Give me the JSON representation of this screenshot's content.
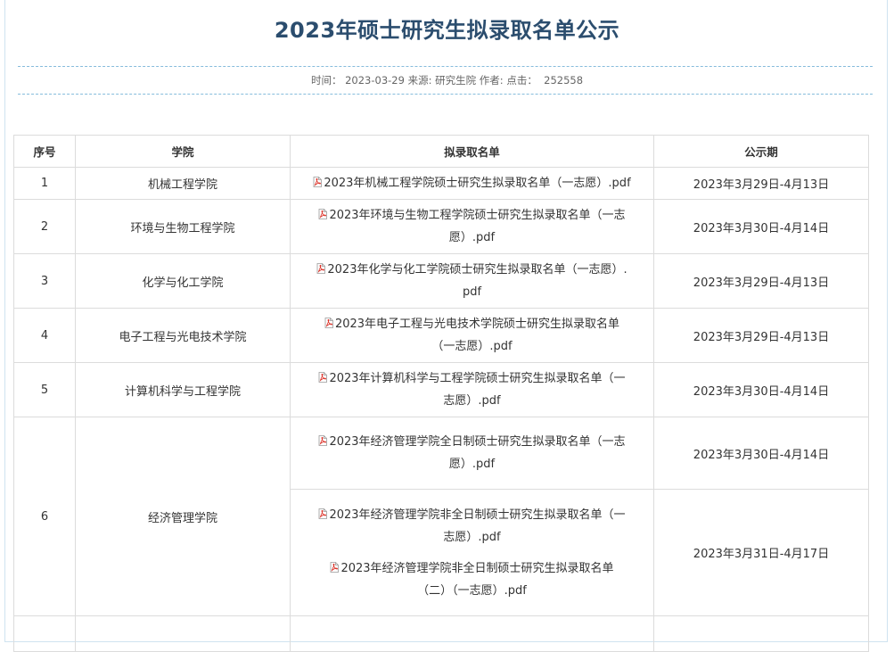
{
  "article": {
    "title": "2023年硕士研究生拟录取名单公示",
    "meta": {
      "time_label": "时间：",
      "time_value": "2023-03-29",
      "source_label": "来源:",
      "source_value": "研究生院",
      "author_label": "作者:",
      "clicks_label": "点击：",
      "clicks_value": "252558"
    }
  },
  "table": {
    "headers": [
      "序号",
      "学院",
      "拟录取名单",
      "公示期"
    ],
    "rows": [
      {
        "no": "1",
        "college": "机械工程学院",
        "files": [
          {
            "line1": "2023年机械工程学院硕士研究生拟录取名单（一志愿）.pdf",
            "line2": ""
          }
        ],
        "period": "2023年3月29日-4月13日"
      },
      {
        "no": "2",
        "college": "环境与生物工程学院",
        "files": [
          {
            "line1": "2023年环境与生物工程学院硕士研究生拟录取名单（一志",
            "line2": "愿）.pdf"
          }
        ],
        "period": "2023年3月30日-4月14日"
      },
      {
        "no": "3",
        "college": "化学与化工学院",
        "files": [
          {
            "line1": "2023年化学与化工学院硕士研究生拟录取名单（一志愿）.",
            "line2": "pdf"
          }
        ],
        "period": "2023年3月29日-4月13日"
      },
      {
        "no": "4",
        "college": "电子工程与光电技术学院",
        "files": [
          {
            "line1": "2023年电子工程与光电技术学院硕士研究生拟录取名单",
            "line2": "（一志愿）.pdf"
          }
        ],
        "period": "2023年3月29日-4月13日"
      },
      {
        "no": "5",
        "college": "计算机科学与工程学院",
        "files": [
          {
            "line1": "2023年计算机科学与工程学院硕士研究生拟录取名单（一",
            "line2": "志愿）.pdf"
          }
        ],
        "period": "2023年3月30日-4月14日"
      }
    ],
    "row6": {
      "no": "6",
      "college": "经济管理学院",
      "sub_a": {
        "file": {
          "line1": "2023年经济管理学院全日制硕士研究生拟录取名单（一志",
          "line2": "愿）.pdf"
        },
        "period": "2023年3月30日-4月14日"
      },
      "sub_b": {
        "files": [
          {
            "line1": "2023年经济管理学院非全日制硕士研究生拟录取名单（一",
            "line2": "志愿）.pdf"
          },
          {
            "line1": "2023年经济管理学院非全日制硕士研究生拟录取名单",
            "line2": "（二）（一志愿）.pdf"
          }
        ],
        "period": "2023年3月31日-4月17日"
      }
    }
  },
  "icons": {
    "file": "pdf-icon",
    "pdf_color": "#d9261c"
  }
}
